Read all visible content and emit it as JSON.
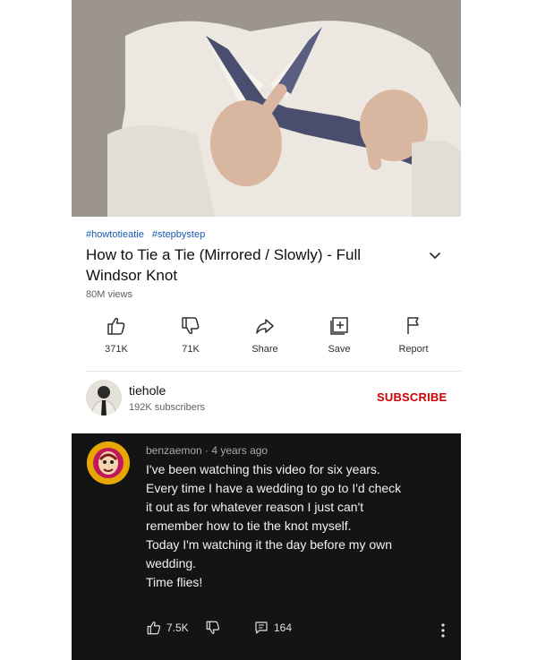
{
  "video": {
    "hashtags": [
      "#howtotieatie",
      "#stepbystep"
    ],
    "title_lines": [
      "How to Tie a Tie (Mirrored / Slowly) - Full",
      "Windsor Knot"
    ],
    "views": "80M views"
  },
  "actions": [
    {
      "label": "371K",
      "icon": "thumbs-up-icon"
    },
    {
      "label": "71K",
      "icon": "thumbs-down-icon"
    },
    {
      "label": "Share",
      "icon": "share-icon"
    },
    {
      "label": "Save",
      "icon": "save-icon"
    },
    {
      "label": "Report",
      "icon": "flag-icon"
    }
  ],
  "channel": {
    "name": "tiehole",
    "subscribers": "192K subscribers",
    "subscribe_label": "SUBSCRIBE"
  },
  "comment": {
    "meta": "benzaemon · 4 years ago",
    "lines": [
      "I've been watching this video for six years.",
      "Every time I have a wedding to go to I'd check",
      "it out as for whatever reason I just can't",
      "remember how to tie the knot myself.",
      "Today I'm watching it the day before my own",
      "wedding.",
      "Time flies!"
    ],
    "likes": "7.5K",
    "replies": "164"
  },
  "colors": {
    "hashtag": "#1a56b0",
    "subscribe": "#cc0000",
    "comment_bg": "#141414"
  }
}
